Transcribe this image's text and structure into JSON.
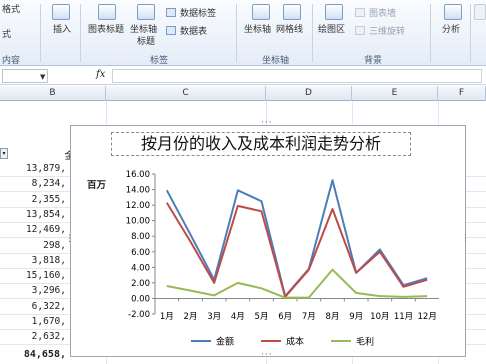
{
  "ribbon": {
    "left_text": [
      "格式",
      "式"
    ],
    "left_group_label": "内容",
    "insert_label": "插入",
    "chart_title_btn": "图表标题",
    "axis_title_btn": "坐标轴",
    "axis_title_btn2": "标题",
    "data_labels_btn": "数据标签",
    "data_table_btn": "数据表",
    "label_group": "标签",
    "axes_btn": "坐标轴",
    "gridlines_btn": "网格线",
    "axes_group": "坐标轴",
    "plot_area_btn": "绘图区",
    "chart_wall_btn": "图表墙",
    "rotation_btn": "三维旋转",
    "background_group": "背景",
    "analysis_btn": "分析"
  },
  "formula_bar": {
    "fx": "fx"
  },
  "columns": [
    "B",
    "C",
    "D",
    "E",
    "F"
  ],
  "cells": {
    "header_partial": "金",
    "values": [
      "13,879,",
      "8,234,",
      "2,355,",
      "13,854,",
      "12,469,",
      "298,",
      "3,818,",
      "15,160,",
      "3,296,",
      "6,322,",
      "1,670,",
      "2,632,"
    ],
    "total": "84,658,"
  },
  "colors": {
    "revenue": "#4a7ebb",
    "cost": "#be4b48",
    "profit": "#98b954"
  },
  "chart_data": {
    "type": "line",
    "title": "按月份的收入及成本利润走势分析",
    "unit_label": "百万",
    "categories": [
      "1月",
      "2月",
      "3月",
      "4月",
      "5月",
      "6月",
      "7月",
      "8月",
      "9月",
      "10月",
      "11月",
      "12月"
    ],
    "ylim": [
      -2,
      16
    ],
    "yticks": [
      "16.00",
      "14.00",
      "12.00",
      "10.00",
      "8.00",
      "6.00",
      "4.00",
      "2.00",
      "0.00",
      "-2.00"
    ],
    "legend_position": "bottom",
    "grid": false,
    "series": [
      {
        "name": "金额",
        "values": [
          13.9,
          8.2,
          2.4,
          13.9,
          12.5,
          0.3,
          3.8,
          15.2,
          3.3,
          6.3,
          1.7,
          2.6
        ]
      },
      {
        "name": "成本",
        "values": [
          12.3,
          7.3,
          2.0,
          11.9,
          11.2,
          0.2,
          3.7,
          11.5,
          3.3,
          6.0,
          1.5,
          2.4
        ]
      },
      {
        "name": "毛利",
        "values": [
          1.6,
          1.0,
          0.4,
          2.0,
          1.3,
          0.1,
          0.1,
          3.7,
          0.7,
          0.3,
          0.2,
          0.3
        ]
      }
    ]
  }
}
